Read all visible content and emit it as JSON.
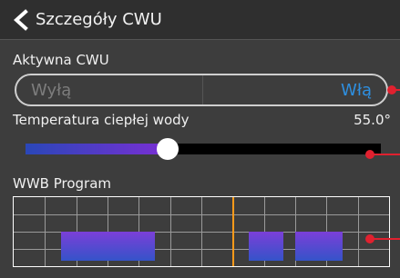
{
  "header": {
    "title": "Szczegóły CWU",
    "back_icon": "chevron-left-icon"
  },
  "active": {
    "label": "Aktywna CWU",
    "options": [
      "Wyłą",
      "Włą"
    ],
    "selected": "Włą"
  },
  "temperature": {
    "label": "Temperatura ciepłej wody",
    "value_text": "55.0°",
    "slider_level": 0.4
  },
  "program": {
    "label": "WWB Program",
    "blocks": [
      {
        "start": 3,
        "end": 9
      },
      {
        "start": 15,
        "end": 17.25
      },
      {
        "start": 18,
        "end": 21
      }
    ],
    "current_hour": 14
  },
  "colors": {
    "accent": "#2e8fe0",
    "marker": "#e0212f",
    "now_line": "#ff9a1a"
  }
}
